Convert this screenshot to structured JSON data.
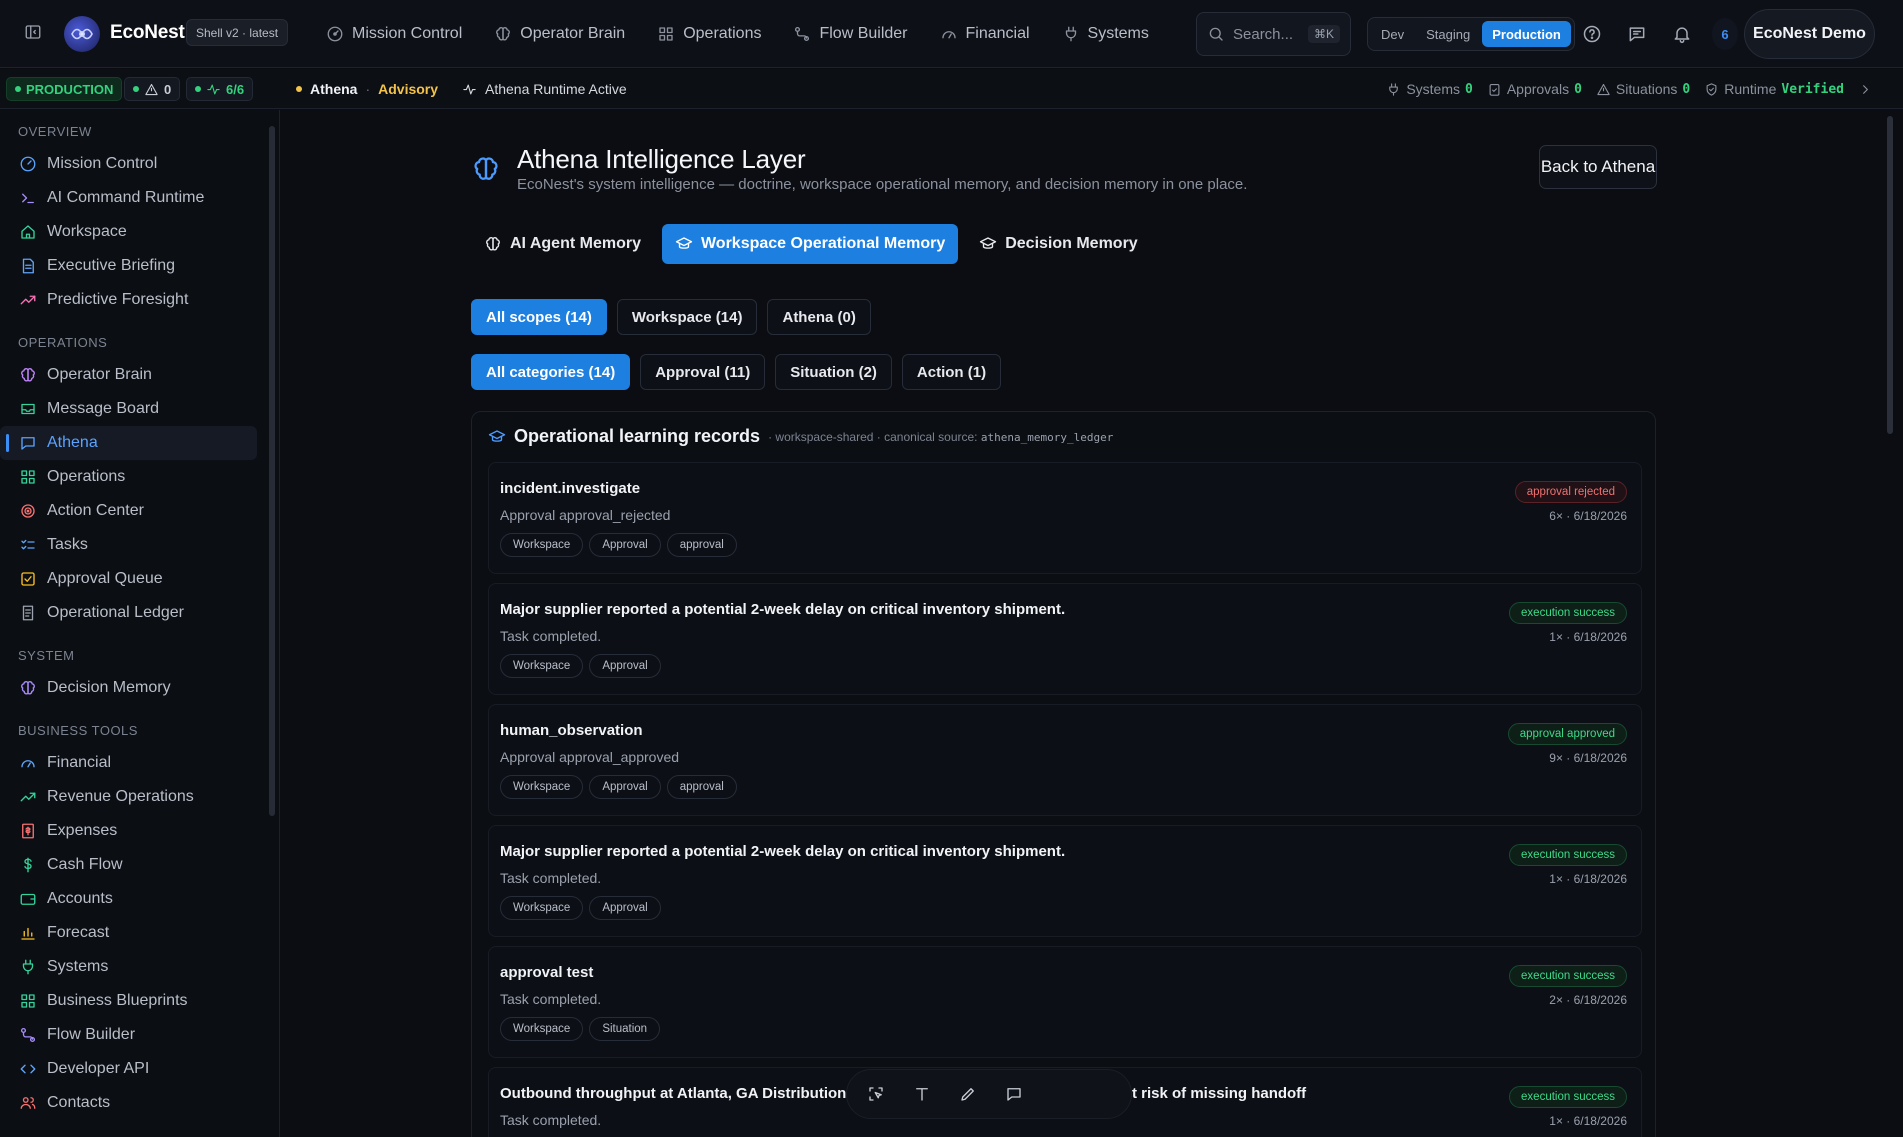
{
  "topnav": {
    "brand": "EcoNest",
    "shell_badge": "Shell v2 · latest",
    "items": [
      {
        "label": "Mission Control",
        "icon": "gauge-icon"
      },
      {
        "label": "Operator Brain",
        "icon": "brain-icon"
      },
      {
        "label": "Operations",
        "icon": "grid-icon"
      },
      {
        "label": "Flow Builder",
        "icon": "flow-icon"
      },
      {
        "label": "Financial",
        "icon": "dial-icon"
      },
      {
        "label": "Systems",
        "icon": "plug-icon"
      }
    ],
    "search_placeholder": "Search...",
    "search_shortcut": "⌘K",
    "env": {
      "options": [
        "Dev",
        "Staging",
        "Production"
      ],
      "active": "Production"
    },
    "notification_count": "6",
    "account": "EcoNest Demo"
  },
  "statusbar": {
    "env_label": "PRODUCTION",
    "warnings": "0",
    "health": "6/6",
    "context_name": "Athena",
    "context_mode": "Advisory",
    "runtime": "Athena Runtime Active",
    "stats": [
      {
        "label": "Systems",
        "value": "0"
      },
      {
        "label": "Approvals",
        "value": "0"
      },
      {
        "label": "Situations",
        "value": "0"
      },
      {
        "label": "Runtime",
        "value": "Verified"
      }
    ]
  },
  "sidebar": {
    "sections": [
      {
        "title": "OVERVIEW",
        "items": [
          "Mission Control",
          "AI Command Runtime",
          "Workspace",
          "Executive Briefing",
          "Predictive Foresight"
        ]
      },
      {
        "title": "OPERATIONS",
        "items": [
          "Operator Brain",
          "Message Board",
          "Athena",
          "Operations",
          "Action Center",
          "Tasks",
          "Approval Queue",
          "Operational Ledger"
        ]
      },
      {
        "title": "SYSTEM",
        "items": [
          "Decision Memory"
        ]
      },
      {
        "title": "BUSINESS TOOLS",
        "items": [
          "Financial",
          "Revenue Operations",
          "Expenses",
          "Cash Flow",
          "Accounts",
          "Forecast",
          "Systems",
          "Business Blueprints",
          "Flow Builder",
          "Developer API",
          "Contacts"
        ]
      }
    ],
    "active": "Athena"
  },
  "page": {
    "title": "Athena Intelligence Layer",
    "subtitle": "EcoNest's system intelligence — doctrine, workspace operational memory, and decision memory in one place.",
    "back_button": "Back to Athena",
    "tabs": [
      "AI Agent Memory",
      "Workspace Operational Memory",
      "Decision Memory"
    ],
    "active_tab": "Workspace Operational Memory",
    "scope_filters": [
      "All scopes (14)",
      "Workspace (14)",
      "Athena (0)"
    ],
    "category_filters": [
      "All categories (14)",
      "Approval (11)",
      "Situation (2)",
      "Action (1)"
    ]
  },
  "panel": {
    "title": "Operational learning records",
    "meta_prefix": "· workspace-shared · canonical source:",
    "meta_source": "athena_memory_ledger"
  },
  "records": [
    {
      "title": "incident.investigate",
      "desc": "Approval approval_rejected",
      "tags": [
        "Workspace",
        "Approval",
        "approval"
      ],
      "status": "approval rejected",
      "status_kind": "rej",
      "count": "6× · 6/18/2026"
    },
    {
      "title": "Major supplier reported a potential 2-week delay on critical inventory shipment.",
      "desc": "Task completed.",
      "tags": [
        "Workspace",
        "Approval"
      ],
      "status": "execution success",
      "status_kind": "ok",
      "count": "1× · 6/18/2026"
    },
    {
      "title": "human_observation",
      "desc": "Approval approval_approved",
      "tags": [
        "Workspace",
        "Approval",
        "approval"
      ],
      "status": "approval approved",
      "status_kind": "ok",
      "count": "9× · 6/18/2026"
    },
    {
      "title": "Major supplier reported a potential 2-week delay on critical inventory shipment.",
      "desc": "Task completed.",
      "tags": [
        "Workspace",
        "Approval"
      ],
      "status": "execution success",
      "status_kind": "ok",
      "count": "1× · 6/18/2026"
    },
    {
      "title": "approval test",
      "desc": "Task completed.",
      "tags": [
        "Workspace",
        "Situation"
      ],
      "status": "execution success",
      "status_kind": "ok",
      "count": "2× · 6/18/2026"
    },
    {
      "title_left": "Outbound throughput at Atlanta, GA Distribution",
      "title_right": "t risk of missing handoff",
      "desc": "Task completed.",
      "tags": [],
      "status": "execution success",
      "status_kind": "ok",
      "count": "1× · 6/18/2026"
    }
  ]
}
